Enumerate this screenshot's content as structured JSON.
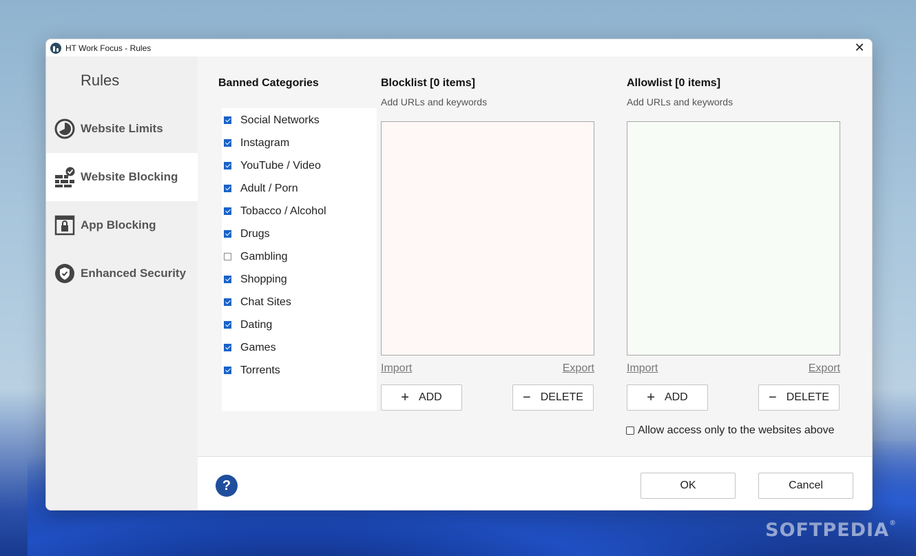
{
  "window": {
    "title": "HT Work Focus - Rules",
    "close_glyph": "✕"
  },
  "sidebar": {
    "title": "Rules",
    "items": [
      {
        "label": "Website Limits",
        "icon": "timer-icon",
        "active": false
      },
      {
        "label": "Website Blocking",
        "icon": "brick-wall-check-icon",
        "active": true
      },
      {
        "label": "App Blocking",
        "icon": "app-lock-icon",
        "active": false
      },
      {
        "label": "Enhanced Security",
        "icon": "shield-check-icon",
        "active": false
      }
    ]
  },
  "categories": {
    "heading": "Banned Categories",
    "items": [
      {
        "label": "Social Networks",
        "checked": true
      },
      {
        "label": "Instagram",
        "checked": true
      },
      {
        "label": "YouTube / Video",
        "checked": true
      },
      {
        "label": "Adult / Porn",
        "checked": true
      },
      {
        "label": "Tobacco / Alcohol",
        "checked": true
      },
      {
        "label": "Drugs",
        "checked": true
      },
      {
        "label": "Gambling",
        "checked": false
      },
      {
        "label": "Shopping",
        "checked": true
      },
      {
        "label": "Chat Sites",
        "checked": true
      },
      {
        "label": "Dating",
        "checked": true
      },
      {
        "label": "Games",
        "checked": true
      },
      {
        "label": "Torrents",
        "checked": true
      }
    ]
  },
  "blocklist": {
    "title": "Blocklist [0 items]",
    "subtitle": "Add URLs and keywords",
    "import_label": "Import",
    "export_label": "Export",
    "add_label": "ADD",
    "delete_label": "DELETE",
    "box_color": "#fff8f7"
  },
  "allowlist": {
    "title": "Allowlist [0 items]",
    "subtitle": "Add URLs and keywords",
    "import_label": "Import",
    "export_label": "Export",
    "add_label": "ADD",
    "delete_label": "DELETE",
    "box_color": "#f7fcf6",
    "allow_only_label": "Allow access only to the websites above",
    "allow_only_checked": false
  },
  "footer": {
    "help_glyph": "?",
    "ok_label": "OK",
    "cancel_label": "Cancel"
  },
  "watermark": "SOFTPEDIA",
  "colors": {
    "accent": "#1a63c8",
    "help_button": "#1f4f9c"
  }
}
